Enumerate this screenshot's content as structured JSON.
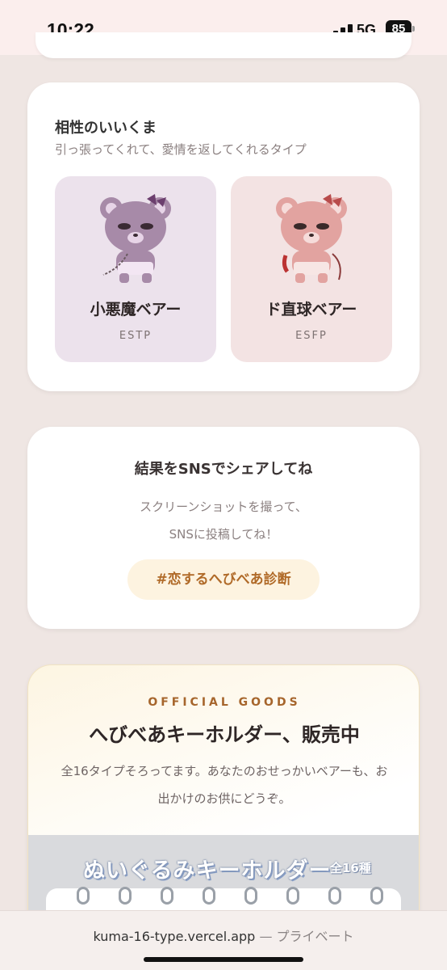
{
  "status_bar": {
    "time": "10:22",
    "network": "5G",
    "battery": "85"
  },
  "compatibility": {
    "title": "相性のいいくま",
    "subtitle": "引っ張ってくれて、愛情を返してくれるタイプ",
    "bears": [
      {
        "name": "小悪魔ベアー",
        "type": "ESTP",
        "color": "#a78aa8"
      },
      {
        "name": "ド直球ベアー",
        "type": "ESFP",
        "color": "#e2a3a0"
      }
    ]
  },
  "share": {
    "title": "結果をSNSでシェアしてね",
    "line1": "スクリーンショットを撮って、",
    "line2": "SNSに投稿してね！",
    "hashtag": "#恋するへびべあ診断"
  },
  "goods": {
    "eyebrow": "OFFICIAL GOODS",
    "title": "へびべあキーホルダー、販売中",
    "description": "全16タイプそろってます。あなたのおせっかいベアーも、お出かけのお供にどうぞ。",
    "banner_title": "ぬいぐるみキーホルダー",
    "banner_count": "全16種"
  },
  "url_bar": {
    "domain": "kuma-16-type.vercel.app",
    "mode": "— プライベート"
  }
}
